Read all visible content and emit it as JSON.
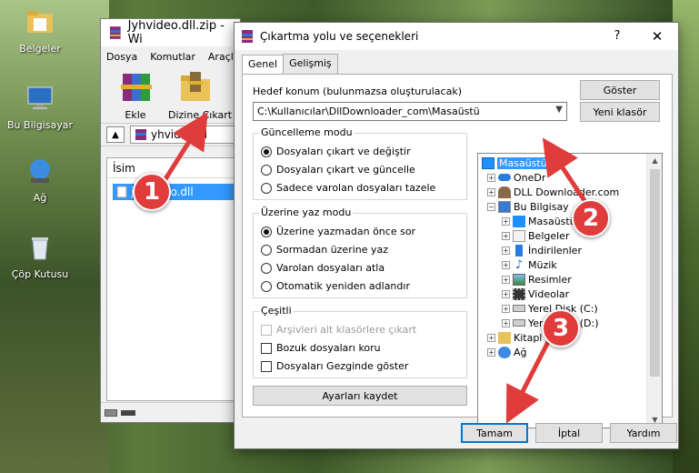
{
  "desktop": {
    "icons": [
      {
        "label": "Belgeler"
      },
      {
        "label": "Bu Bilgisayar"
      },
      {
        "label": "Ağ"
      },
      {
        "label": "Çöp Kutusu"
      }
    ]
  },
  "winrar": {
    "title": "Jyhvideo.dll.zip - Wi",
    "menu": [
      "Dosya",
      "Komutlar",
      "Araçla"
    ],
    "toolbar": {
      "add_label": "Ekle",
      "extract_label": "Dizine Çıkart"
    },
    "address": "yhvideo.dl",
    "list_header": "İsim",
    "file_name": "jyhvideo.dll"
  },
  "dialog": {
    "title": "Çıkartma yolu ve seçenekleri",
    "help": "?",
    "tabs": [
      "Genel",
      "Gelişmiş"
    ],
    "dest_label": "Hedef konum (bulunmazsa oluşturulacak)",
    "dest_path": "C:\\Kullanıcılar\\DllDownloader_com\\Masaüstü",
    "show_button": "Göster",
    "new_folder_button": "Yeni klasör",
    "update_group": {
      "title": "Güncelleme modu",
      "options": [
        {
          "label": "Dosyaları çıkart ve değiştir",
          "selected": true
        },
        {
          "label": "Dosyaları çıkart ve güncelle",
          "selected": false
        },
        {
          "label": "Sadece varolan dosyaları tazele",
          "selected": false
        }
      ]
    },
    "overwrite_group": {
      "title": "Üzerine yaz modu",
      "options": [
        {
          "label": "Üzerine yazmadan önce sor",
          "selected": true
        },
        {
          "label": "Sormadan üzerine yaz",
          "selected": false
        },
        {
          "label": "Varolan dosyaları atla",
          "selected": false
        },
        {
          "label": "Otomatik yeniden adlandır",
          "selected": false
        }
      ]
    },
    "misc_group": {
      "title": "Çeşitli",
      "options": [
        {
          "label": "Arşivleri alt klasörlere çıkart",
          "checked": false,
          "disabled": true
        },
        {
          "label": "Bozuk dosyaları koru",
          "checked": false,
          "disabled": false
        },
        {
          "label": "Dosyaları Gezginde göster",
          "checked": false,
          "disabled": false
        }
      ]
    },
    "save_settings_button": "Ayarları kaydet",
    "tree": [
      {
        "label": "Masaüstü",
        "selected": true
      },
      {
        "label": "OneDr"
      },
      {
        "label": "DLL Downloader.com"
      },
      {
        "label": "Bu Bilgisay"
      },
      {
        "label": "Masaüstü"
      },
      {
        "label": "Belgeler"
      },
      {
        "label": "İndirilenler"
      },
      {
        "label": "Müzik"
      },
      {
        "label": "Resimler"
      },
      {
        "label": "Videolar"
      },
      {
        "label": "Yerel Disk (C:)"
      },
      {
        "label": "Yerel Disk (D:)"
      },
      {
        "label": "Kitapl"
      },
      {
        "label": "Ağ"
      }
    ],
    "ok_button": "Tamam",
    "cancel_button": "İptal",
    "help_button": "Yardım"
  },
  "steps": [
    "1",
    "2",
    "3"
  ],
  "colors": {
    "selection": "#3399ff",
    "badge": "#e03c3c",
    "accent": "#0078d7"
  }
}
